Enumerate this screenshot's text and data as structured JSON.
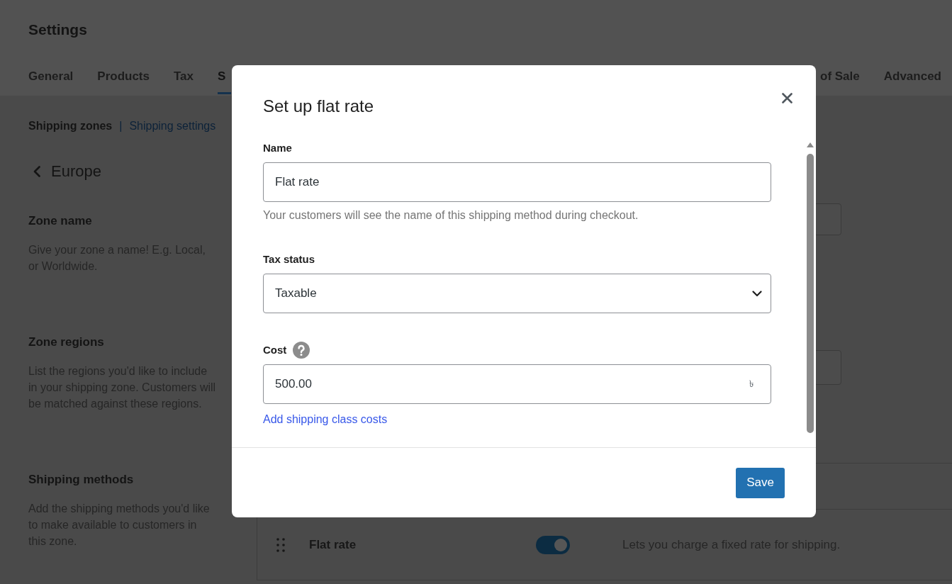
{
  "page": {
    "title": "Settings",
    "tabs": [
      {
        "label": "General",
        "selected": false
      },
      {
        "label": "Products",
        "selected": false
      },
      {
        "label": "Tax",
        "selected": false
      },
      {
        "label": "S",
        "selected": true
      },
      {
        "label": "of Sale",
        "selected": false
      },
      {
        "label": "Advanced",
        "selected": false
      }
    ],
    "subnav": [
      {
        "label": "Shipping zones",
        "selected": true
      },
      {
        "label": "Shipping settings",
        "selected": false
      }
    ],
    "subnav_separator": "|",
    "zone": {
      "title": "Europe",
      "sections": [
        {
          "kind": "text",
          "title": "Zone name",
          "description": "Give your zone a name! E.g. Local, or Worldwide."
        },
        {
          "kind": "region-select",
          "title": "Zone regions",
          "description": "List the regions you'd like to include in your shipping zone. Customers will be matched against these regions."
        },
        {
          "kind": "methods-table",
          "title": "Shipping methods",
          "description": "Add the shipping methods you'd like to make available to customers in this zone.",
          "methods": [
            {
              "name": "Flat rate",
              "enabled": true,
              "description": "Lets you charge a fixed rate for shipping."
            }
          ]
        }
      ]
    }
  },
  "dialog": {
    "title": "Set up flat rate",
    "fields": [
      {
        "kind": "text",
        "label": "Name",
        "value": "Flat rate",
        "help": "Your customers will see the name of this shipping method during checkout."
      },
      {
        "kind": "select",
        "label": "Tax status",
        "value": "Taxable"
      },
      {
        "kind": "text",
        "label": "Cost",
        "help_icon": true,
        "value": "500.00",
        "suffix": "৳"
      }
    ],
    "action_link": "Add shipping class costs",
    "buttons": [
      "Save"
    ]
  }
}
